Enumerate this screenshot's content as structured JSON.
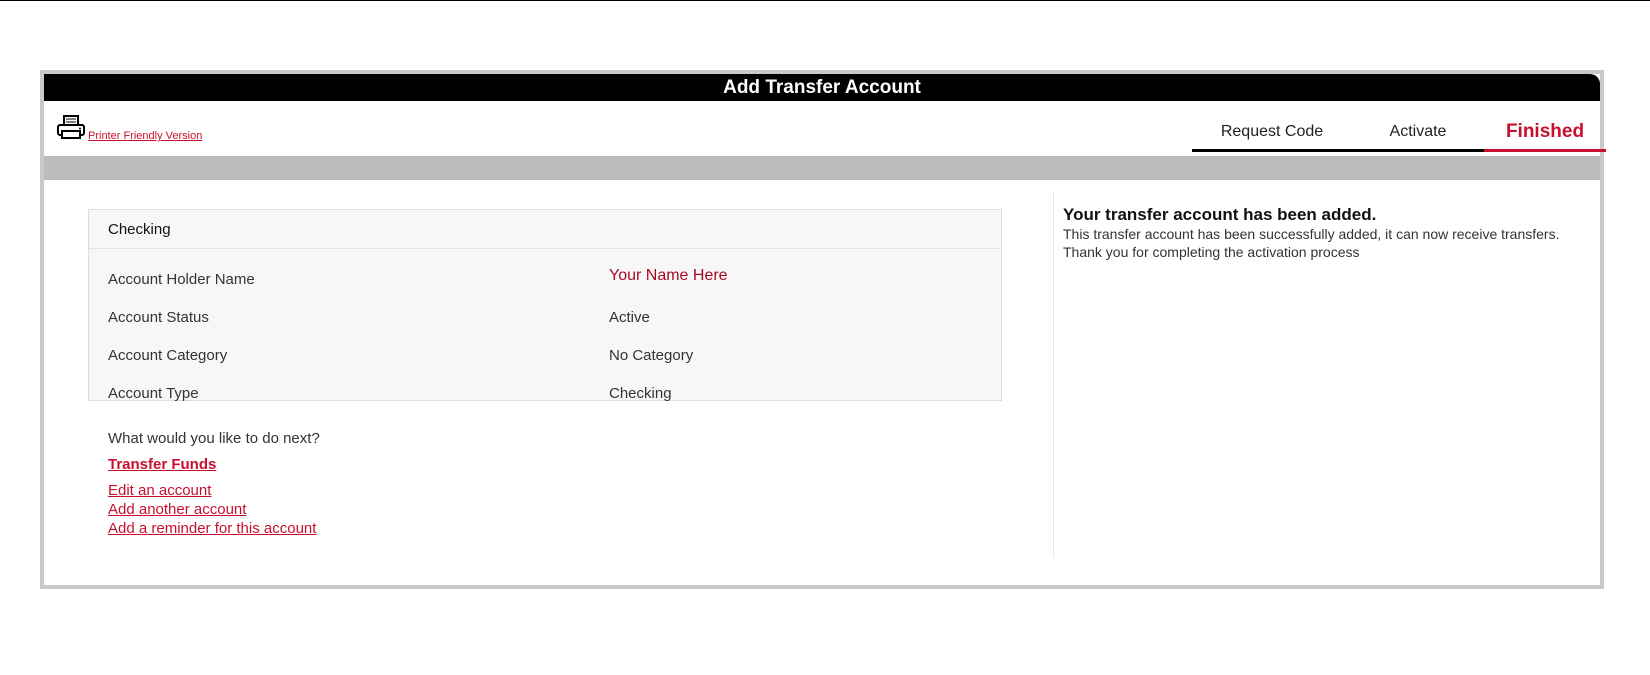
{
  "page": {
    "title": "Add Transfer Account",
    "printer_link": "Printer Friendly Version"
  },
  "icons": {
    "printer": "printer-icon"
  },
  "steps": [
    {
      "label": "Request Code",
      "state": "done"
    },
    {
      "label": "Activate",
      "state": "done"
    },
    {
      "label": "Finished",
      "state": "current"
    }
  ],
  "account": {
    "header": "Checking",
    "rows": [
      {
        "label": "Account Holder Name",
        "value": "Your Name Here"
      },
      {
        "label": "Account Status",
        "value": "Active"
      },
      {
        "label": "Account Category",
        "value": "No Category"
      },
      {
        "label": "Account Type",
        "value": "Checking"
      }
    ]
  },
  "next": {
    "question": "What would you like to do next?",
    "primary_link": "Transfer Funds",
    "links": [
      "Edit an account",
      "Add another account",
      "Add a reminder for this account"
    ]
  },
  "confirmation": {
    "title": "Your transfer account has been added.",
    "body": "This transfer account has been successfully added, it can now receive transfers. Thank you for completing the activation process"
  },
  "colors": {
    "accent": "#c8102e",
    "header_bg": "#000000",
    "band": "#bcbcbc",
    "panel_border": "#c9c9c9"
  }
}
